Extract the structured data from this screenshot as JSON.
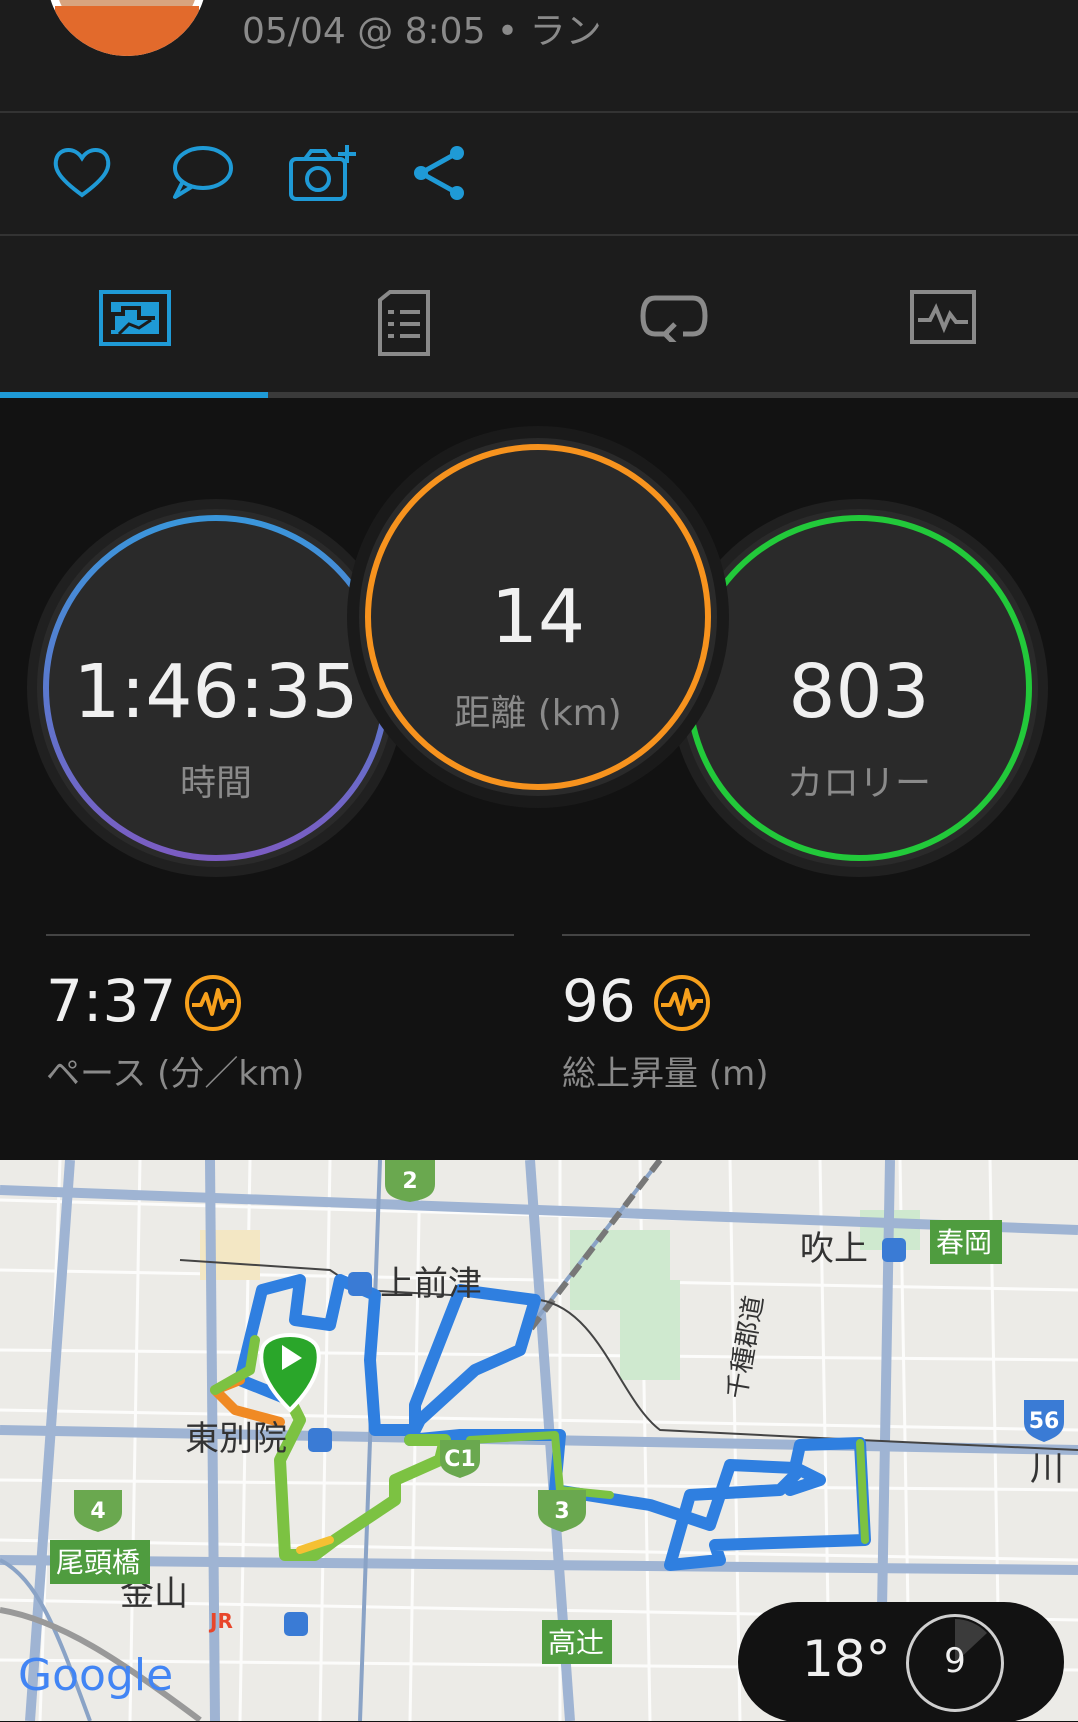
{
  "activity": {
    "meta": "05/04 @ 8:05 • ラン"
  },
  "actions": {
    "like_icon": "heart-icon",
    "comment_icon": "comment-icon",
    "photo_icon": "camera-add-icon",
    "share_icon": "share-icon"
  },
  "tabs": [
    {
      "icon": "stats-overview-icon",
      "active": true
    },
    {
      "icon": "details-list-icon",
      "active": false
    },
    {
      "icon": "laps-icon",
      "active": false
    },
    {
      "icon": "charts-icon",
      "active": false
    }
  ],
  "summary": {
    "time": {
      "value": "1:46:35",
      "label": "時間"
    },
    "distance": {
      "value": "14",
      "label": "距離 (km)"
    },
    "calories": {
      "value": "803",
      "label": "カロリー"
    }
  },
  "stats": {
    "pace": {
      "value": "7:37",
      "label": "ペース (分／km)",
      "icon": "heart-rate-icon"
    },
    "elevation": {
      "value": "96",
      "label": "総上昇量 (m)",
      "icon": "heart-rate-icon"
    }
  },
  "colors": {
    "accent": "#1f9ad6",
    "time_ring_start": "#3a96db",
    "time_ring_end": "#7b5cc2",
    "distance_ring": "#f7931e",
    "calories_ring": "#22c93a",
    "stat_icon": "#f7a01c"
  },
  "map": {
    "labels": {
      "kamimaezu": "上前津",
      "higashibetsuin": "東別院",
      "fukiage": "吹上",
      "harukaoka": "春岡",
      "chikusa_street": "千種郡道",
      "kanayama": "金山",
      "otobashi": "尾頭橋",
      "takatsuji": "高辻",
      "kawa": "川",
      "google": "Google"
    },
    "route_badges": [
      "2",
      "C1",
      "3",
      "4",
      "56"
    ],
    "station_marks": [
      "JR"
    ]
  },
  "weather": {
    "temperature": "18°",
    "wind_speed": "9"
  }
}
